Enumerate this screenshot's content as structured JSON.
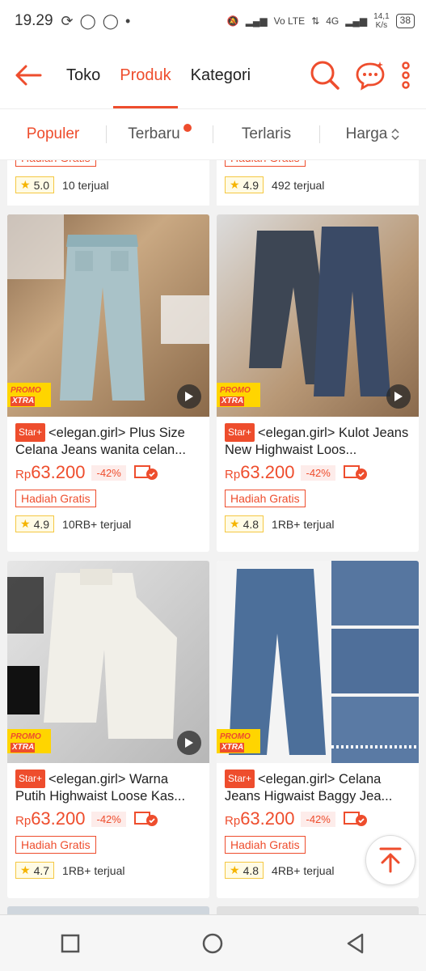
{
  "statusbar": {
    "time": "19.29",
    "network_speed": "14,1\nK/s",
    "lte": "Vo LTE",
    "g4": "4G",
    "battery": "38"
  },
  "header": {
    "tabs": [
      {
        "label": "Toko"
      },
      {
        "label": "Produk"
      },
      {
        "label": "Kategori"
      }
    ],
    "active_tab": "Produk",
    "accent": "#ee4d2d"
  },
  "sort": {
    "items": [
      {
        "label": "Populer"
      },
      {
        "label": "Terbaru"
      },
      {
        "label": "Terlaris"
      },
      {
        "label": "Harga"
      }
    ]
  },
  "top_partial": [
    {
      "badge": "Hadiah Gratis",
      "rating": "5.0",
      "sold": "10 terjual"
    },
    {
      "badge": "Hadiah Gratis",
      "rating": "4.9",
      "sold": "492 terjual"
    }
  ],
  "products": [
    {
      "badge_star": "Star+",
      "title": "<elegan.girl> Plus Size Celana Jeans wanita celan...",
      "price_currency": "Rp",
      "price": "63.200",
      "discount": "-42%",
      "gift": "Hadiah Gratis",
      "rating": "4.9",
      "sold": "10RB+ terjual",
      "promo_top": "PROMO",
      "promo_bottom": "XTRA"
    },
    {
      "badge_star": "Star+",
      "title": "<elegan.girl> Kulot Jeans New Highwaist Loos...",
      "price_currency": "Rp",
      "price": "63.200",
      "discount": "-42%",
      "gift": "Hadiah Gratis",
      "rating": "4.8",
      "sold": "1RB+ terjual",
      "promo_top": "PROMO",
      "promo_bottom": "XTRA"
    },
    {
      "badge_star": "Star+",
      "title": "<elegan.girl> Warna Putih Highwaist Loose Kas...",
      "price_currency": "Rp",
      "price": "63.200",
      "discount": "-42%",
      "gift": "Hadiah Gratis",
      "rating": "4.7",
      "sold": "1RB+ terjual",
      "promo_top": "PROMO",
      "promo_bottom": "XTRA"
    },
    {
      "badge_star": "Star+",
      "title": "<elegan.girl> Celana Jeans Higwaist Baggy Jea...",
      "price_currency": "Rp",
      "price": "63.200",
      "discount": "-42%",
      "gift": "Hadiah Gratis",
      "rating": "4.8",
      "sold": "4RB+ terjual",
      "promo_top": "PROMO",
      "promo_bottom": "XTRA"
    }
  ],
  "icons": [
    "back-arrow-icon",
    "search-icon",
    "chat-icon",
    "more-vert-icon",
    "play-icon",
    "star-icon",
    "free-shipping-icon",
    "scroll-top-icon"
  ]
}
